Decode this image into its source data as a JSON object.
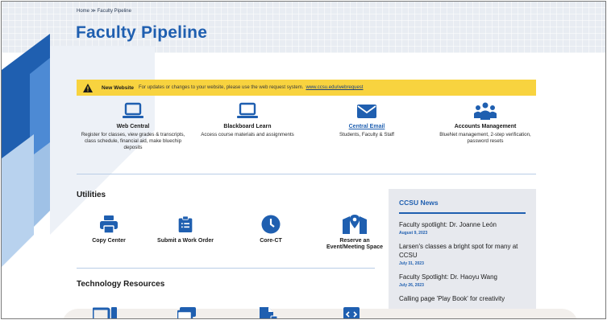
{
  "breadcrumb": "Home ≫ Faculty Pipeline",
  "page_title": "Faculty Pipeline",
  "alert": {
    "title": "New Website",
    "text": "For updates or changes to your website, please use the web request system.",
    "link": "www.ccsu.edu/webrequest"
  },
  "quick_links": [
    {
      "title": "Web Central",
      "desc": "Register for classes, view grades & transcripts, class schedule, financial aid, make bluechip deposits",
      "icon": "laptop-icon"
    },
    {
      "title": "Blackboard Learn",
      "desc": "Access course materials and assignments",
      "icon": "laptop-icon"
    },
    {
      "title": "Central Email",
      "desc": "Students, Faculty & Staff",
      "icon": "envelope-icon"
    },
    {
      "title": "Accounts Management",
      "desc": "BlueNet management, 2-step verification, password resets",
      "icon": "users-icon"
    }
  ],
  "utilities": {
    "heading": "Utilities",
    "items": [
      {
        "label": "Copy Center",
        "icon": "printer-icon"
      },
      {
        "label": "Submit a Work Order",
        "icon": "clipboard-icon"
      },
      {
        "label": "Core-CT",
        "icon": "clock-icon"
      },
      {
        "label": "Reserve an Event/Meeting Space",
        "icon": "map-pin-icon"
      }
    ]
  },
  "technology": {
    "heading": "Technology Resources"
  },
  "news": {
    "heading": "CCSU News",
    "items": [
      {
        "headline": "Faculty spotlight: Dr. Joanne León",
        "date": "August 9, 2023"
      },
      {
        "headline": "Larsen's classes a bright spot for many at CCSU",
        "date": "July 31, 2023"
      },
      {
        "headline": "Faculty Spotlight: Dr. Haoyu Wang",
        "date": "July 26, 2023"
      },
      {
        "headline": "Calling page 'Play Book' for creativity",
        "date": ""
      }
    ]
  },
  "colors": {
    "brand_blue": "#1f5fb0",
    "alert_yellow": "#f8d33f",
    "news_bg": "#e7e9ee"
  }
}
